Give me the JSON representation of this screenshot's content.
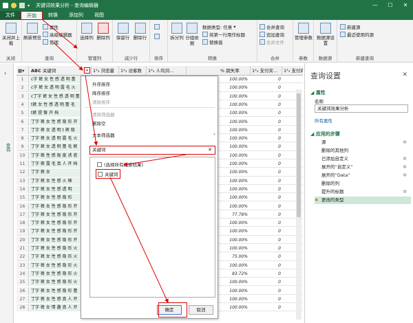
{
  "window": {
    "title": "关键词效果分析 - 查询编辑器"
  },
  "tabs": [
    {
      "label": "文件"
    },
    {
      "label": "开始"
    },
    {
      "label": "转换"
    },
    {
      "label": "添加列"
    },
    {
      "label": "视图"
    }
  ],
  "ribbon": {
    "close_load": "关闭并上载",
    "refresh_preview": "刷新预览",
    "properties": "属性",
    "advanced_editor": "高级编辑器",
    "manage": "管理",
    "choose_columns": "选择列",
    "remove_columns": "删除列",
    "keep_rows": "保留行",
    "remove_rows": "删除行",
    "split_column": "拆分列",
    "group_by": "分组依据",
    "data_type": "数据类型: 任意",
    "first_row_header": "将第一行用作标题",
    "replace_values": "替换值",
    "merge_queries": "合并查询",
    "append_queries": "追加查询",
    "combine_files": "合并文件",
    "manage_params": "管理参数",
    "data_source_settings": "数据源设置",
    "new_source": "新建源",
    "recent_sources": "最近使用的源",
    "groups": {
      "close": "关闭",
      "query": "查询",
      "manage_columns": "管理列",
      "reduce_rows": "减少行",
      "sort": "排序",
      "transform": "转换",
      "combine": "合并",
      "params": "参数",
      "data_source": "数据源",
      "new_query": "新建查询"
    }
  },
  "left_pane": {
    "label": "查询"
  },
  "grid": {
    "columns": [
      "关键词",
      "浏览量",
      "访客数",
      "人均浏...",
      "跳失率",
      "支付买...",
      "支付商"
    ],
    "rows": [
      {
        "n": "1",
        "kw": "c字 裤 女 性 感 透 明 蕾",
        "pct": "100.00%",
        "zero": "0"
      },
      {
        "n": "2",
        "kw": "c字 裤 女 透 明 露 毛 火",
        "pct": "100.00%",
        "zero": "0"
      },
      {
        "n": "3",
        "kw": "c丁字 裤 女 性 感 透 明 蕾",
        "pct": "100.00%",
        "zero": "0"
      },
      {
        "n": "4",
        "kw": "t裤 女 性 感 透 明 蕾 毛",
        "pct": "100.00%",
        "zero": "0"
      },
      {
        "n": "5",
        "kw": "t裤 提 臀 开 档",
        "pct": "100.00%",
        "zero": "0"
      },
      {
        "n": "6",
        "kw": "丁字 裤 女 性 感 隐 形 开",
        "pct": "100.00%",
        "zero": "0"
      },
      {
        "n": "7",
        "kw": "丁字 裤 女 透 明 t 裤 隐",
        "pct": "100.00%",
        "zero": "0"
      },
      {
        "n": "8",
        "kw": "丁字 裤 女 透 明 露 毛 火",
        "pct": "100.00%",
        "zero": "0"
      },
      {
        "n": "9",
        "kw": "丁字 裤 女 透 明 蕾 毛 裤",
        "pct": "100.00%",
        "zero": "0"
      },
      {
        "n": "10",
        "kw": "丁字 裤 性 感 极 度 诱 惑",
        "pct": "100.00%",
        "zero": "0"
      },
      {
        "n": "11",
        "kw": "丁字 裤 露 毛 真 人 开 档",
        "pct": "100.00%",
        "zero": "0"
      },
      {
        "n": "12",
        "kw": "丁字 裤 女",
        "pct": "100.00%",
        "zero": "0"
      },
      {
        "n": "13",
        "kw": "丁字 裤 女 性 感 火 辣",
        "pct": "100.00%",
        "zero": "0"
      },
      {
        "n": "14",
        "kw": "丁字 裤 女 性 感 透 明",
        "pct": "100.00%",
        "zero": "0"
      },
      {
        "n": "15",
        "kw": "丁字 裤 女 性 感 隐 形",
        "pct": "100.00%",
        "zero": "0"
      },
      {
        "n": "16",
        "kw": "丁字 裤 女 性 感 隐 形 开",
        "pct": "100.00%",
        "zero": "0"
      },
      {
        "n": "17",
        "kw": "丁字 裤 女 性 感 隐 形 开",
        "pct": "77.78%",
        "zero": "0"
      },
      {
        "n": "18",
        "kw": "丁字 裤 女 性 感 隐 形 开",
        "pct": "100.00%",
        "zero": "0"
      },
      {
        "n": "19",
        "kw": "丁字 裤 女 性 感 隐 形 开",
        "pct": "100.00%",
        "zero": "0"
      },
      {
        "n": "20",
        "kw": "丁字 裤 女 性 感 隐 形 开",
        "pct": "100.00%",
        "zero": "0"
      },
      {
        "n": "21",
        "kw": "丁字 裤 女 性 感 隐 形 火",
        "pct": "100.00%",
        "zero": "0"
      },
      {
        "n": "22",
        "kw": "丁字 裤 女 性 感 隐 形 火",
        "pct": "75.00%",
        "zero": "0"
      },
      {
        "n": "23",
        "kw": "丁字 裤 女 性 感 隐 形 火",
        "pct": "100.00%",
        "zero": "0"
      },
      {
        "n": "24",
        "kw": "丁字 裤 女 性 感 隐 形 火",
        "pct": "83.72%",
        "zero": "0"
      },
      {
        "n": "25",
        "kw": "丁字 裤 女 性 感 隐 形 火",
        "pct": "100.00%",
        "zero": "0"
      },
      {
        "n": "26",
        "kw": "丁字 裤 女 性 感 隐 形 蕾",
        "pct": "100.00%",
        "zero": "0"
      },
      {
        "n": "27",
        "kw": "丁字 裤 女 性 感 真 人 开",
        "pct": "100.00%",
        "zero": "0"
      },
      {
        "n": "28",
        "kw": "丁字 裤 女 情 趣 真 人 开",
        "pct": "100.00%",
        "zero": "0"
      }
    ]
  },
  "dropdown": {
    "sort_asc": "升序排序",
    "sort_desc": "降序排序",
    "clear_sort": "清除排序",
    "clear_filter": "清除筛选器",
    "remove_empty": "删除空",
    "text_filters": "文本筛选器",
    "search_value": "关键词",
    "select_all": "(选择所有搜索结果)",
    "item": "关键词",
    "ok": "确定",
    "cancel": "取消"
  },
  "settings": {
    "title": "查询设置",
    "properties": "属性",
    "name_label": "名称",
    "name_value": "关键词效果分析",
    "all_properties": "所有属性",
    "applied_steps": "应用的步骤",
    "steps": [
      {
        "label": "源"
      },
      {
        "label": "删除的其他列"
      },
      {
        "label": "已添加自定义"
      },
      {
        "label": "展开的“自定义”"
      },
      {
        "label": "展开的“Data”"
      },
      {
        "label": "删除的列"
      },
      {
        "label": "提升的标题"
      },
      {
        "label": "更改的类型"
      }
    ]
  }
}
